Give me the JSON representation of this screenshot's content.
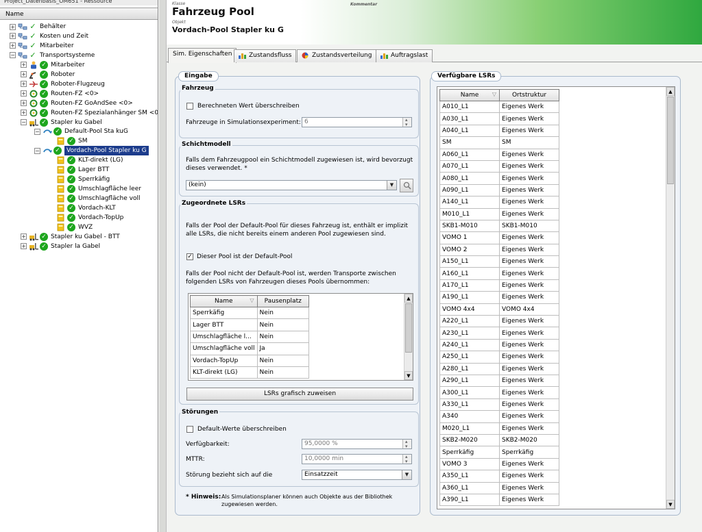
{
  "window_title": "Project_Datenbasis_OM651 - Ressource",
  "tree": {
    "header": "Name",
    "items": [
      {
        "label": "Behälter",
        "icon": "network-icon"
      },
      {
        "label": "Kosten und Zeit",
        "icon": "network-icon"
      },
      {
        "label": "Mitarbeiter",
        "icon": "network-icon"
      },
      {
        "label": "Transportsysteme",
        "icon": "network-icon"
      },
      {
        "label": "Mitarbeiter",
        "icon": "worker-icon"
      },
      {
        "label": "Roboter",
        "icon": "robot-icon"
      },
      {
        "label": "Roboter-Flugzeug",
        "icon": "robot-plane-icon"
      },
      {
        "label": "Routen-FZ <0>",
        "icon": "route-icon"
      },
      {
        "label": "Routen-FZ GoAndSee <0>",
        "icon": "route-icon"
      },
      {
        "label": "Routen-FZ Spezialanhänger SM <0",
        "icon": "route-icon"
      },
      {
        "label": "Stapler ku Gabel",
        "icon": "forklift-icon"
      },
      {
        "label": "Default-Pool Sta kuG",
        "icon": "pool-icon"
      },
      {
        "label": "SM",
        "icon": "lsr-icon"
      },
      {
        "label": "Vordach-Pool Stapler ku G",
        "icon": "pool-icon"
      },
      {
        "label": "KLT-direkt (LG)",
        "icon": "lsr-icon"
      },
      {
        "label": "Lager BTT",
        "icon": "lsr-icon"
      },
      {
        "label": "Sperrkäfig",
        "icon": "lsr-icon"
      },
      {
        "label": "Umschlagfläche leer",
        "icon": "lsr-icon"
      },
      {
        "label": "Umschlagfläche voll",
        "icon": "lsr-icon"
      },
      {
        "label": "Vordach-KLT",
        "icon": "lsr-icon"
      },
      {
        "label": "Vordach-TopUp",
        "icon": "lsr-icon"
      },
      {
        "label": "WVZ",
        "icon": "lsr-icon"
      },
      {
        "label": "Stapler ku Gabel - BTT",
        "icon": "forklift-icon"
      },
      {
        "label": "Stapler la Gabel",
        "icon": "forklift-icon"
      }
    ]
  },
  "header": {
    "klasse_label": "Klasse",
    "klasse_value": "Fahrzeug Pool",
    "kommentar_label": "Kommentar",
    "objekt_label": "Objekt",
    "objekt_value": "Vordach-Pool Stapler ku G"
  },
  "tabs": [
    {
      "label": "Sim. Eigenschaften",
      "active": true
    },
    {
      "label": "Zustandsfluss"
    },
    {
      "label": "Zustandsverteilung"
    },
    {
      "label": "Auftragslast"
    }
  ],
  "eingabe": {
    "title": "Eingabe",
    "fahrzeug": {
      "title": "Fahrzeug",
      "override_label": "Berechneten Wert überschreiben",
      "override_checked": false,
      "count_label": "Fahrzeuge in Simulationsexperiment:",
      "count_value": "6"
    },
    "schichtmodell": {
      "title": "Schichtmodell",
      "description": "Falls dem Fahrzeugpool ein Schichtmodell zugewiesen ist, wird bevorzugt dieses verwendet. *",
      "value": "(kein)"
    },
    "zugeordnete": {
      "title": "Zugeordnete LSRs",
      "text1": "Falls der Pool der Default-Pool für dieses Fahrzeug ist, enthält er implizit alle LSRs, die nicht bereits einem anderen Pool zugewiesen sind.",
      "default_label": "Dieser Pool ist der Default-Pool",
      "default_checked": true,
      "text2": "Falls der Pool nicht der Default-Pool ist, werden Transporte zwischen folgenden LSRs von Fahrzeugen dieses Pools übernommen:",
      "table_headers": [
        "Name",
        "Pausenplatz"
      ],
      "table_rows": [
        [
          "Sperrkäfig",
          "Nein"
        ],
        [
          "Lager BTT",
          "Nein"
        ],
        [
          "Umschlagfläche l...",
          "Nein"
        ],
        [
          "Umschlagfläche voll",
          "Ja"
        ],
        [
          "Vordach-TopUp",
          "Nein"
        ],
        [
          "KLT-direkt (LG)",
          "Nein"
        ]
      ],
      "button_label": "LSRs grafisch zuweisen"
    },
    "stoerungen": {
      "title": "Störungen",
      "override_label": "Default-Werte überschreiben",
      "override_checked": false,
      "avail_label": "Verfügbarkeit:",
      "avail_value": "95,0000 %",
      "mttr_label": "MTTR:",
      "mttr_value": "10,0000 min",
      "ref_label": "Störung bezieht sich auf die",
      "ref_value": "Einsatzzeit"
    },
    "hint_label": "* Hinweis:",
    "hint_text": "Als Simulationsplaner können auch Objekte aus der Bibliothek zugewiesen werden."
  },
  "lsrs": {
    "title": "Verfügbare LSRs",
    "headers": [
      "Name",
      "Ortstruktur"
    ],
    "rows": [
      [
        "A010_L1",
        "Eigenes Werk"
      ],
      [
        "A030_L1",
        "Eigenes Werk"
      ],
      [
        "A040_L1",
        "Eigenes Werk"
      ],
      [
        "SM",
        "SM"
      ],
      [
        "A060_L1",
        "Eigenes Werk"
      ],
      [
        "A070_L1",
        "Eigenes Werk"
      ],
      [
        "A080_L1",
        "Eigenes Werk"
      ],
      [
        "A090_L1",
        "Eigenes Werk"
      ],
      [
        "A140_L1",
        "Eigenes Werk"
      ],
      [
        "M010_L1",
        "Eigenes Werk"
      ],
      [
        "SKB1-M010",
        "SKB1-M010"
      ],
      [
        "VOMO 1",
        "Eigenes Werk"
      ],
      [
        "VOMO 2",
        "Eigenes Werk"
      ],
      [
        "A150_L1",
        "Eigenes Werk"
      ],
      [
        "A160_L1",
        "Eigenes Werk"
      ],
      [
        "A170_L1",
        "Eigenes Werk"
      ],
      [
        "A190_L1",
        "Eigenes Werk"
      ],
      [
        "VOMO 4x4",
        "VOMO 4x4"
      ],
      [
        "A220_L1",
        "Eigenes Werk"
      ],
      [
        "A230_L1",
        "Eigenes Werk"
      ],
      [
        "A240_L1",
        "Eigenes Werk"
      ],
      [
        "A250_L1",
        "Eigenes Werk"
      ],
      [
        "A280_L1",
        "Eigenes Werk"
      ],
      [
        "A290_L1",
        "Eigenes Werk"
      ],
      [
        "A300_L1",
        "Eigenes Werk"
      ],
      [
        "A330_L1",
        "Eigenes Werk"
      ],
      [
        "A340",
        "Eigenes Werk"
      ],
      [
        "M020_L1",
        "Eigenes Werk"
      ],
      [
        "SKB2-M020",
        "SKB2-M020"
      ],
      [
        "Sperrkäfig",
        "Sperrkäfig"
      ],
      [
        "VOMO 3",
        "Eigenes Werk"
      ],
      [
        "A350_L1",
        "Eigenes Werk"
      ],
      [
        "A360_L1",
        "Eigenes Werk"
      ],
      [
        "A390_L1",
        "Eigenes Werk"
      ]
    ]
  },
  "colors": {
    "header_green": "#2fa83f",
    "selection": "#1c3c8c",
    "check_green": "#1ea61e"
  }
}
